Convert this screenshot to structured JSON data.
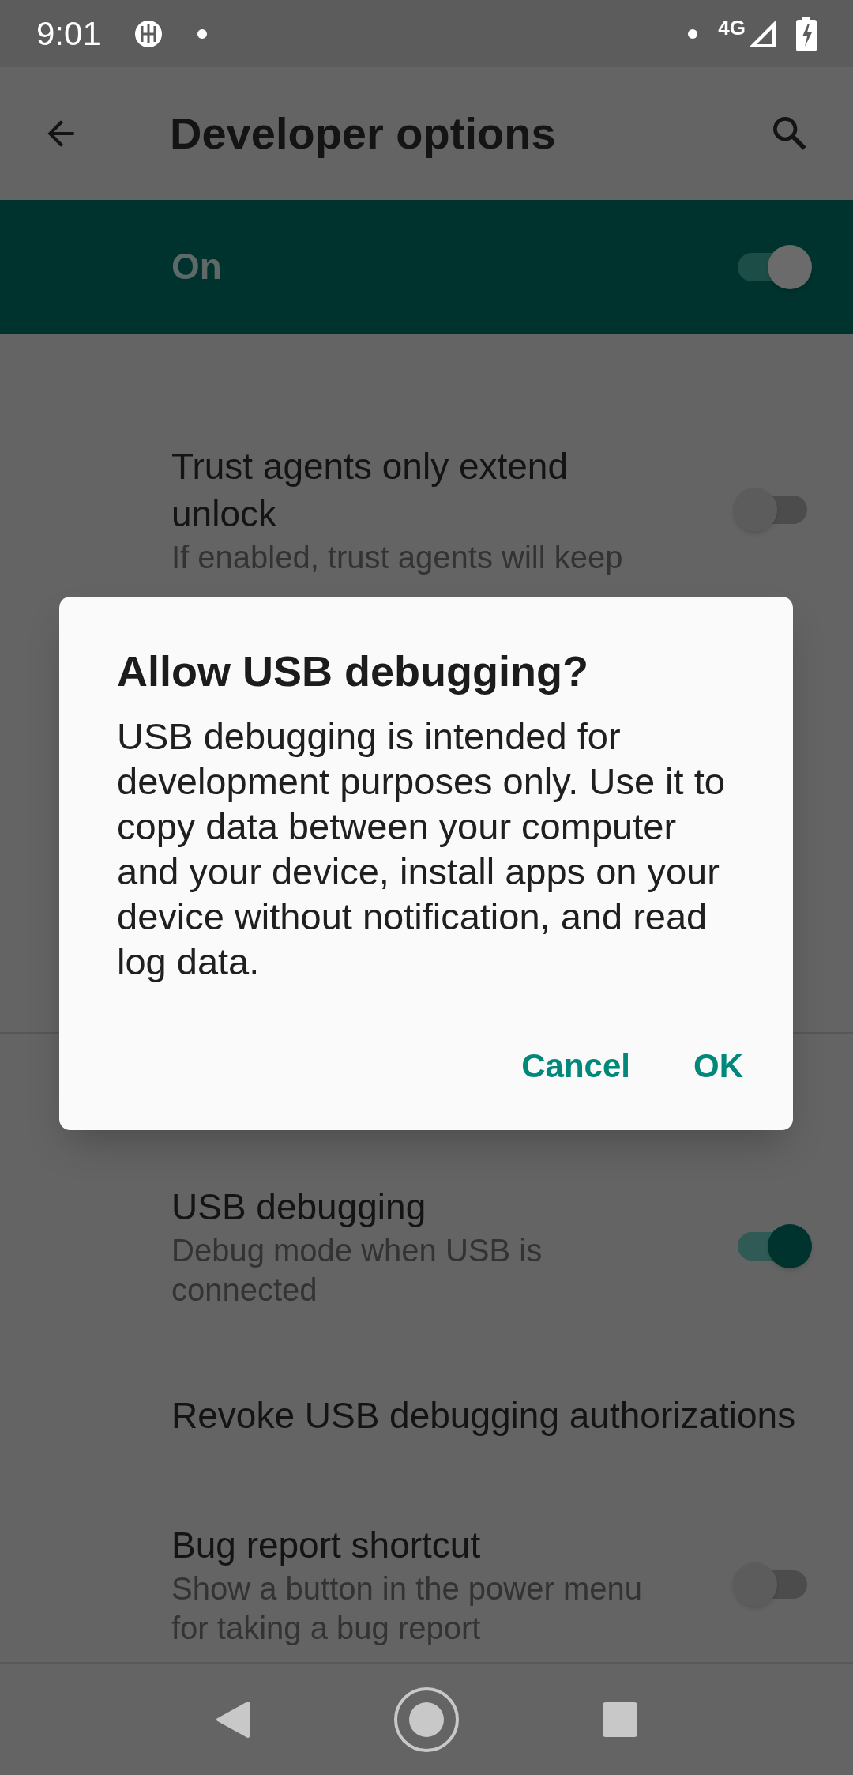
{
  "status_bar": {
    "time": "9:01",
    "network": "4G"
  },
  "toolbar": {
    "title": "Developer options"
  },
  "master_switch": {
    "label": "On",
    "on": true
  },
  "list": {
    "items": [
      {
        "kind": "setting",
        "title": "Trust agents only extend unlock",
        "subtitle": "If enabled, trust agents will keep",
        "on": false
      },
      {
        "kind": "divider"
      },
      {
        "kind": "setting",
        "title": "USB debugging",
        "subtitle": "Debug mode when USB is connected",
        "on": true
      },
      {
        "kind": "setting",
        "title": "Revoke USB debugging authorizations"
      },
      {
        "kind": "setting",
        "title": "Bug report shortcut",
        "subtitle": "Show a button in the power menu for taking a bug report",
        "on": false
      }
    ]
  },
  "dialog": {
    "title": "Allow USB debugging?",
    "body": "USB debugging is intended for development purposes only. Use it to copy data between your computer and your device, install apps on your device without notification, and read log data.",
    "buttons": [
      "Cancel",
      "OK"
    ]
  }
}
